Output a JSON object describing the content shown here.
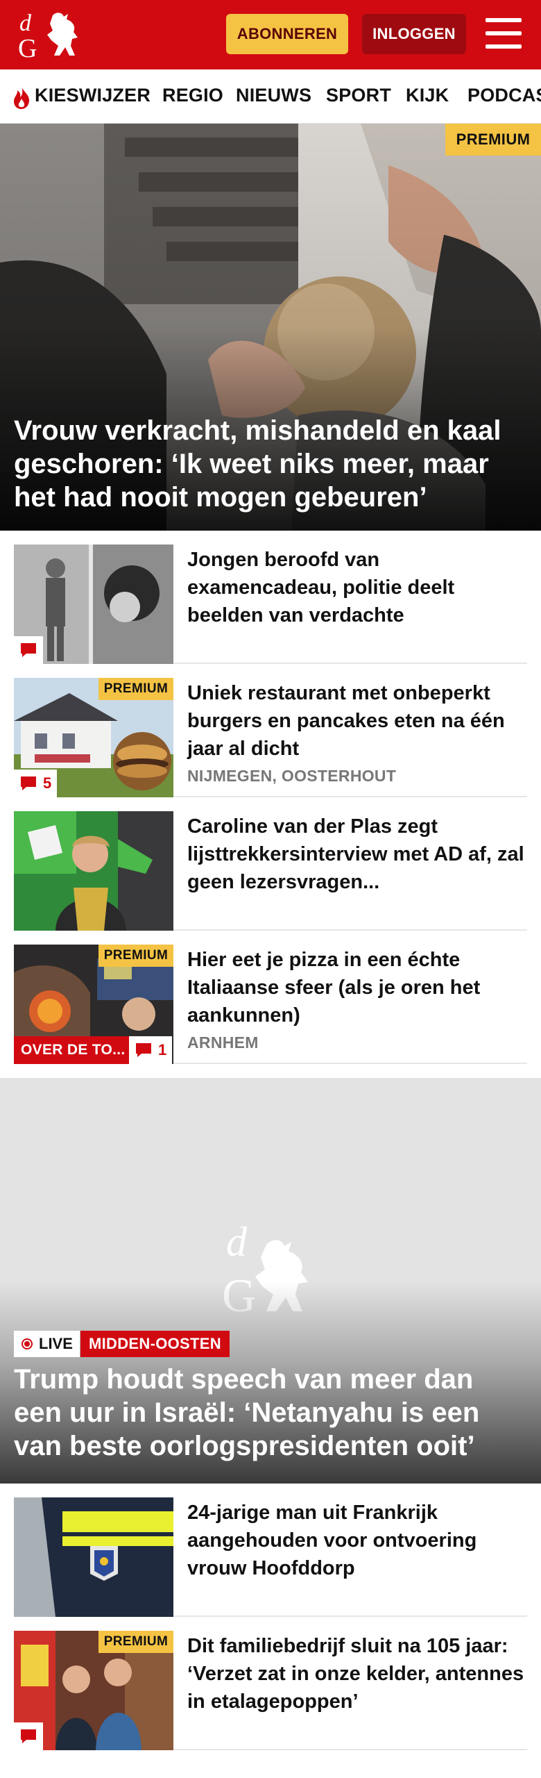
{
  "header": {
    "logo_text": "dG",
    "subscribe_label": "ABONNEREN",
    "login_label": "INLOGGEN",
    "brand_color": "#d10a11"
  },
  "nav": {
    "items": [
      "KIESWIJZER",
      "REGIO",
      "NIEUWS",
      "SPORT",
      "KIJK",
      "PODCAST"
    ],
    "first_icon": "flame-icon"
  },
  "hero": {
    "badge": "PREMIUM",
    "title": "Vrouw verkracht, mishandeld en kaal geschoren: ‘Ik weet niks meer, maar het had nooit mogen gebeuren’"
  },
  "articles": [
    {
      "title": "Jongen beroofd van examencadeau, politie deelt beelden van verdachte",
      "location": "",
      "comments": "",
      "premium": "",
      "tag": ""
    },
    {
      "title": "Uniek restaurant met onbeperkt burgers en pancakes eten na één jaar al dicht",
      "location": "NIJMEGEN, OOSTERHOUT",
      "comments": "5",
      "premium": "PREMIUM",
      "tag": ""
    },
    {
      "title": "Caroline van der Plas zegt lijsttrekkersinterview met AD af, zal geen lezersvragen...",
      "location": "",
      "comments": "",
      "premium": "",
      "tag": ""
    },
    {
      "title": "Hier eet je pizza in een échte Italiaanse sfeer (als je oren het aankunnen)",
      "location": "ARNHEM",
      "comments": "1",
      "premium": "PREMIUM",
      "tag": "OVER DE TO..."
    }
  ],
  "live": {
    "logo_text": "dG",
    "live_label": "LIVE",
    "topic": "MIDDEN-OOSTEN",
    "title": "Trump houdt speech van meer dan een uur in Israël: ‘Netanyahu is een van beste oorlogspresidenten ooit’"
  },
  "articles2": [
    {
      "title": "24-jarige man uit Frankrijk aangehouden voor ontvoering vrouw Hoofddorp",
      "premium": ""
    },
    {
      "title": "Dit familiebedrijf sluit na 105 jaar: ‘Verzet zat in onze kelder, antennes in etalagepoppen’",
      "premium": "PREMIUM"
    }
  ]
}
